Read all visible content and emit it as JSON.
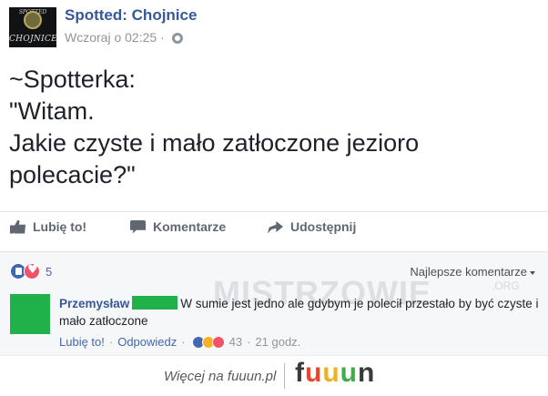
{
  "post": {
    "page_name": "Spotted: Chojnice",
    "timestamp": "Wczoraj o 02:25 ·",
    "avatar_brand_top": "SPOTTED",
    "avatar_brand_bottom": "CHOJNICE",
    "text_lines": [
      "~Spotterka:",
      "\"Witam.",
      "Jakie czyste i mało zatłoczone jezioro",
      "polecacie?\""
    ]
  },
  "actions": {
    "like": "Lubię to!",
    "comment": "Komentarze",
    "share": "Udostępnij"
  },
  "reactions": {
    "count": "5"
  },
  "comments_sort": "Najlepsze komentarze",
  "watermark": {
    "main": "MISTRZOWIE",
    "sub": ".ORG"
  },
  "comment": {
    "author": "Przemysław",
    "text": "W sumie jest jedno ale gdybym je polecił przestało by być czyste i mało zatłoczone",
    "like_label": "Lubię to!",
    "reply_label": "Odpowiedz",
    "reaction_count": "43",
    "age": "21 godz."
  },
  "footer": {
    "tagline": "Więcej na fuuun.pl",
    "logo_letters": [
      "f",
      "u",
      "u",
      "u",
      "n"
    ],
    "logo_colors": [
      "#3a3a3a",
      "#e8452c",
      "#f2b01e",
      "#3fae49",
      "#3a3a3a"
    ]
  },
  "colors": {
    "link_blue": "#365899",
    "redaction_green": "#21b14a"
  }
}
